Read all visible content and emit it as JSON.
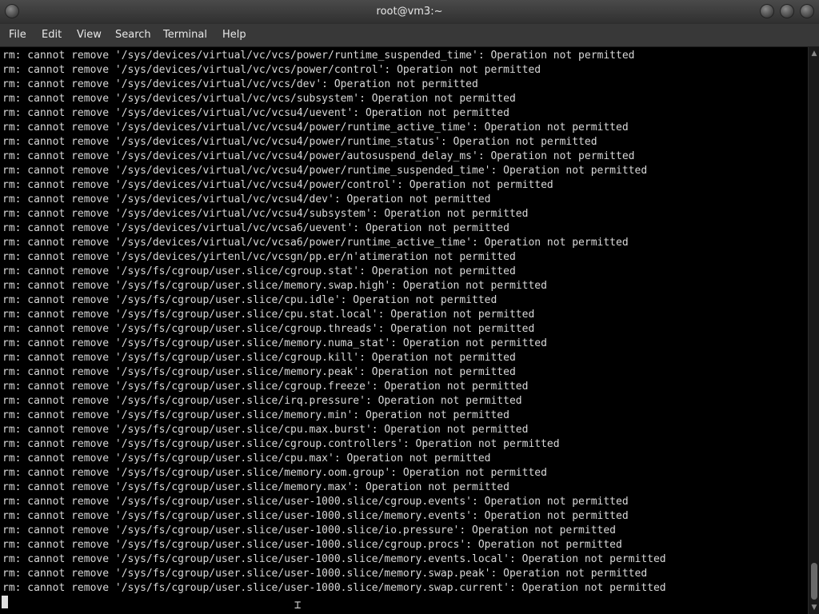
{
  "window": {
    "title": "root@vm3:~"
  },
  "menu": [
    "File",
    "Edit",
    "View",
    "Search",
    "Terminal",
    "Help"
  ],
  "terminal": {
    "lines": [
      "rm: cannot remove '/sys/devices/virtual/vc/vcs/power/runtime_suspended_time': Operation not permitted",
      "rm: cannot remove '/sys/devices/virtual/vc/vcs/power/control': Operation not permitted",
      "rm: cannot remove '/sys/devices/virtual/vc/vcs/dev': Operation not permitted",
      "rm: cannot remove '/sys/devices/virtual/vc/vcs/subsystem': Operation not permitted",
      "rm: cannot remove '/sys/devices/virtual/vc/vcsu4/uevent': Operation not permitted",
      "rm: cannot remove '/sys/devices/virtual/vc/vcsu4/power/runtime_active_time': Operation not permitted",
      "rm: cannot remove '/sys/devices/virtual/vc/vcsu4/power/runtime_status': Operation not permitted",
      "rm: cannot remove '/sys/devices/virtual/vc/vcsu4/power/autosuspend_delay_ms': Operation not permitted",
      "rm: cannot remove '/sys/devices/virtual/vc/vcsu4/power/runtime_suspended_time': Operation not permitted",
      "rm: cannot remove '/sys/devices/virtual/vc/vcsu4/power/control': Operation not permitted",
      "rm: cannot remove '/sys/devices/virtual/vc/vcsu4/dev': Operation not permitted",
      "rm: cannot remove '/sys/devices/virtual/vc/vcsu4/subsystem': Operation not permitted",
      "rm: cannot remove '/sys/devices/virtual/vc/vcsa6/uevent': Operation not permitted",
      "rm: cannot remove '/sys/devices/virtual/vc/vcsa6/power/runtime_active_time': Operation not permitted",
      "rm: cannot remove '/sys/devices/yirtenl/vc/vcsgn/pp.er/n'atimeration not permitted",
      "rm: cannot remove '/sys/fs/cgroup/user.slice/cgroup.stat': Operation not permitted",
      "rm: cannot remove '/sys/fs/cgroup/user.slice/memory.swap.high': Operation not permitted",
      "rm: cannot remove '/sys/fs/cgroup/user.slice/cpu.idle': Operation not permitted",
      "rm: cannot remove '/sys/fs/cgroup/user.slice/cpu.stat.local': Operation not permitted",
      "rm: cannot remove '/sys/fs/cgroup/user.slice/cgroup.threads': Operation not permitted",
      "rm: cannot remove '/sys/fs/cgroup/user.slice/memory.numa_stat': Operation not permitted",
      "rm: cannot remove '/sys/fs/cgroup/user.slice/cgroup.kill': Operation not permitted",
      "rm: cannot remove '/sys/fs/cgroup/user.slice/memory.peak': Operation not permitted",
      "rm: cannot remove '/sys/fs/cgroup/user.slice/cgroup.freeze': Operation not permitted",
      "rm: cannot remove '/sys/fs/cgroup/user.slice/irq.pressure': Operation not permitted",
      "rm: cannot remove '/sys/fs/cgroup/user.slice/memory.min': Operation not permitted",
      "rm: cannot remove '/sys/fs/cgroup/user.slice/cpu.max.burst': Operation not permitted",
      "rm: cannot remove '/sys/fs/cgroup/user.slice/cgroup.controllers': Operation not permitted",
      "rm: cannot remove '/sys/fs/cgroup/user.slice/cpu.max': Operation not permitted",
      "rm: cannot remove '/sys/fs/cgroup/user.slice/memory.oom.group': Operation not permitted",
      "rm: cannot remove '/sys/fs/cgroup/user.slice/memory.max': Operation not permitted",
      "rm: cannot remove '/sys/fs/cgroup/user.slice/user-1000.slice/cgroup.events': Operation not permitted",
      "rm: cannot remove '/sys/fs/cgroup/user.slice/user-1000.slice/memory.events': Operation not permitted",
      "rm: cannot remove '/sys/fs/cgroup/user.slice/user-1000.slice/io.pressure': Operation not permitted",
      "rm: cannot remove '/sys/fs/cgroup/user.slice/user-1000.slice/cgroup.procs': Operation not permitted",
      "rm: cannot remove '/sys/fs/cgroup/user.slice/user-1000.slice/memory.events.local': Operation not permitted",
      "rm: cannot remove '/sys/fs/cgroup/user.slice/user-1000.slice/memory.swap.peak': Operation not permitted",
      "rm: cannot remove '/sys/fs/cgroup/user.slice/user-1000.slice/memory.swap.current': Operation not permitted"
    ]
  },
  "icons": {
    "window_buttons": [
      "minimize-icon",
      "maximize-icon",
      "close-icon"
    ],
    "menu_icon": "window-menu-icon",
    "mouse_pointer": "text-ibeam-cursor-icon"
  },
  "colors": {
    "terminal_bg": "#000000",
    "terminal_fg": "#d8d8d8",
    "titlebar_bg": "#3a3a3a",
    "menubar_bg": "#383838"
  }
}
